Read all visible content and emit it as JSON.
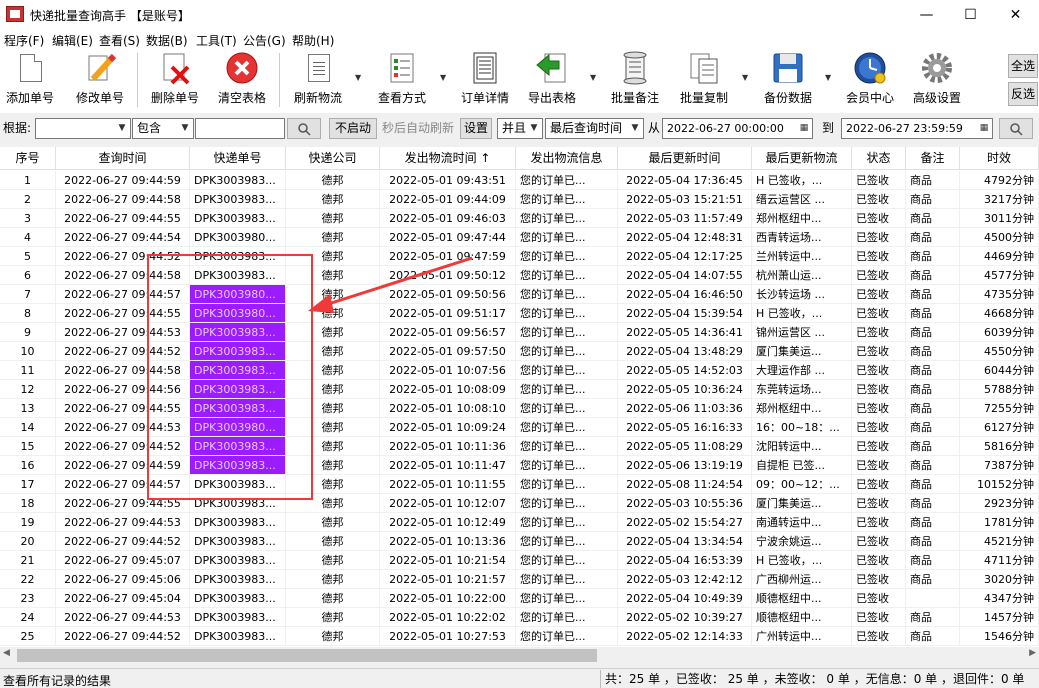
{
  "title": "快递批量查询高手 【是账号】",
  "window_controls": {
    "minimize": "—",
    "maximize": "☐",
    "close": "✕"
  },
  "menu": [
    "程序(F)",
    "编辑(E)",
    "查看(S)",
    "数据(B)",
    "工具(T)",
    "公告(G)",
    "帮助(H)"
  ],
  "toolbar": [
    "添加单号",
    "修改单号",
    "删除单号",
    "清空表格",
    "刷新物流",
    "查看方式",
    "订单详情",
    "导出表格",
    "批量备注",
    "批量复制",
    "备份数据",
    "会员中心",
    "高级设置"
  ],
  "select_panel": {
    "select_all": "全选",
    "invert": "反选"
  },
  "filter": {
    "basis_label": "根据:",
    "basis_value": "",
    "match_value": "包含",
    "search_value": "",
    "auto_refresh_btn": "不启动",
    "auto_refresh_text": "秒后自动刷新",
    "settings_btn": "设置",
    "logic_value": "并且",
    "time_field": "最后查询时间",
    "from_label": "从",
    "from_value": "2022-06-27 00:00:00",
    "to_label": "到",
    "to_value": "2022-06-27 23:59:59"
  },
  "columns": [
    "序号",
    "查询时间",
    "快递单号",
    "快递公司",
    "发出物流时间 ↑",
    "发出物流信息",
    "最后更新时间",
    "最后更新物流",
    "状态",
    "备注",
    "时效"
  ],
  "rows": [
    [
      "1",
      "2022-06-27 09:44:59",
      "DPK3003983...",
      "德邦",
      "2022-05-01 09:43:51",
      "您的订单已...",
      "2022-05-04 17:36:45",
      "H 已签收，...",
      "已签收",
      "商品",
      "4792分钟"
    ],
    [
      "2",
      "2022-06-27 09:44:58",
      "DPK3003983...",
      "德邦",
      "2022-05-01 09:44:09",
      "您的订单已...",
      "2022-05-03 15:21:51",
      "缙云运营区 ...",
      "已签收",
      "商品",
      "3217分钟"
    ],
    [
      "3",
      "2022-06-27 09:44:55",
      "DPK3003983...",
      "德邦",
      "2022-05-01 09:46:03",
      "您的订单已...",
      "2022-05-03 11:57:49",
      "郑州枢纽中...",
      "已签收",
      "商品",
      "3011分钟"
    ],
    [
      "4",
      "2022-06-27 09:44:54",
      "DPK3003980...",
      "德邦",
      "2022-05-01 09:47:44",
      "您的订单已...",
      "2022-05-04 12:48:31",
      "西青转运场...",
      "已签收",
      "商品",
      "4500分钟"
    ],
    [
      "5",
      "2022-06-27 09:44:52",
      "DPK3003983...",
      "德邦",
      "2022-05-01 09:47:59",
      "您的订单已...",
      "2022-05-04 12:17:25",
      "兰州转运中...",
      "已签收",
      "商品",
      "4469分钟"
    ],
    [
      "6",
      "2022-06-27 09:44:58",
      "DPK3003983...",
      "德邦",
      "2022-05-01 09:50:12",
      "您的订单已...",
      "2022-05-04 14:07:55",
      "杭州萧山运...",
      "已签收",
      "商品",
      "4577分钟"
    ],
    [
      "7",
      "2022-06-27 09:44:57",
      "DPK3003980...",
      "德邦",
      "2022-05-01 09:50:56",
      "您的订单已...",
      "2022-05-04 16:46:50",
      "长沙转运场 ...",
      "已签收",
      "商品",
      "4735分钟"
    ],
    [
      "8",
      "2022-06-27 09:44:55",
      "DPK3003980...",
      "德邦",
      "2022-05-01 09:51:17",
      "您的订单已...",
      "2022-05-04 15:39:54",
      "H 已签收，...",
      "已签收",
      "商品",
      "4668分钟"
    ],
    [
      "9",
      "2022-06-27 09:44:53",
      "DPK3003983...",
      "德邦",
      "2022-05-01 09:56:57",
      "您的订单已...",
      "2022-05-05 14:36:41",
      "锦州运营区 ...",
      "已签收",
      "商品",
      "6039分钟"
    ],
    [
      "10",
      "2022-06-27 09:44:52",
      "DPK3003983...",
      "德邦",
      "2022-05-01 09:57:50",
      "您的订单已...",
      "2022-05-04 13:48:29",
      "厦门集美运...",
      "已签收",
      "商品",
      "4550分钟"
    ],
    [
      "11",
      "2022-06-27 09:44:58",
      "DPK3003983...",
      "德邦",
      "2022-05-01 10:07:56",
      "您的订单已...",
      "2022-05-05 14:52:03",
      "大理运作部 ...",
      "已签收",
      "商品",
      "6044分钟"
    ],
    [
      "12",
      "2022-06-27 09:44:56",
      "DPK3003983...",
      "德邦",
      "2022-05-01 10:08:09",
      "您的订单已...",
      "2022-05-05 10:36:24",
      "东莞转运场...",
      "已签收",
      "商品",
      "5788分钟"
    ],
    [
      "13",
      "2022-06-27 09:44:55",
      "DPK3003983...",
      "德邦",
      "2022-05-01 10:08:10",
      "您的订单已...",
      "2022-05-06 11:03:36",
      "郑州枢纽中...",
      "已签收",
      "商品",
      "7255分钟"
    ],
    [
      "14",
      "2022-06-27 09:44:53",
      "DPK3003980...",
      "德邦",
      "2022-05-01 10:09:24",
      "您的订单已...",
      "2022-05-05 16:16:33",
      "16：00~18：...",
      "已签收",
      "商品",
      "6127分钟"
    ],
    [
      "15",
      "2022-06-27 09:44:52",
      "DPK3003983...",
      "德邦",
      "2022-05-01 10:11:36",
      "您的订单已...",
      "2022-05-05 11:08:29",
      "沈阳转运中...",
      "已签收",
      "商品",
      "5816分钟"
    ],
    [
      "16",
      "2022-06-27 09:44:59",
      "DPK3003983...",
      "德邦",
      "2022-05-01 10:11:47",
      "您的订单已...",
      "2022-05-06 13:19:19",
      "自提柜 已签...",
      "已签收",
      "商品",
      "7387分钟"
    ],
    [
      "17",
      "2022-06-27 09:44:57",
      "DPK3003983...",
      "德邦",
      "2022-05-01 10:11:55",
      "您的订单已...",
      "2022-05-08 11:24:54",
      "09：00~12：...",
      "已签收",
      "商品",
      "10152分钟"
    ],
    [
      "18",
      "2022-06-27 09:44:55",
      "DPK3003983...",
      "德邦",
      "2022-05-01 10:12:07",
      "您的订单已...",
      "2022-05-03 10:55:36",
      "厦门集美运...",
      "已签收",
      "商品",
      "2923分钟"
    ],
    [
      "19",
      "2022-06-27 09:44:53",
      "DPK3003983...",
      "德邦",
      "2022-05-01 10:12:49",
      "您的订单已...",
      "2022-05-02 15:54:27",
      "南通转运中...",
      "已签收",
      "商品",
      "1781分钟"
    ],
    [
      "20",
      "2022-06-27 09:44:52",
      "DPK3003983...",
      "德邦",
      "2022-05-01 10:13:36",
      "您的订单已...",
      "2022-05-04 13:34:54",
      "宁波余姚运...",
      "已签收",
      "商品",
      "4521分钟"
    ],
    [
      "21",
      "2022-06-27 09:45:07",
      "DPK3003983...",
      "德邦",
      "2022-05-01 10:21:54",
      "您的订单已...",
      "2022-05-04 16:53:39",
      "H 已签收，...",
      "已签收",
      "商品",
      "4711分钟"
    ],
    [
      "22",
      "2022-06-27 09:45:06",
      "DPK3003983...",
      "德邦",
      "2022-05-01 10:21:57",
      "您的订单已...",
      "2022-05-03 12:42:12",
      "广西柳州运...",
      "已签收",
      "商品",
      "3020分钟"
    ],
    [
      "23",
      "2022-06-27 09:45:04",
      "DPK3003983...",
      "德邦",
      "2022-05-01 10:22:00",
      "您的订单已...",
      "2022-05-04 10:49:39",
      "顺德枢纽中...",
      "已签收",
      "",
      "4347分钟"
    ],
    [
      "24",
      "2022-06-27 09:44:53",
      "DPK3003983...",
      "德邦",
      "2022-05-01 10:22:02",
      "您的订单已...",
      "2022-05-02 10:39:27",
      "顺德枢纽中...",
      "已签收",
      "商品",
      "1457分钟"
    ],
    [
      "25",
      "2022-06-27 09:44:52",
      "DPK3003983...",
      "德邦",
      "2022-05-01 10:27:53",
      "您的订单已...",
      "2022-05-02 12:14:33",
      "广州转运中...",
      "已签收",
      "商品",
      "1546分钟"
    ]
  ],
  "scroll_arrows": {
    "left": "◀",
    "right": "▶"
  },
  "status": {
    "left": "查看所有记录的结果",
    "right": "共：25 单 ，已签收： 25 单 ，未签收： 0 单 ，无信息：0 单 ，退回件：0 单"
  },
  "colors": {
    "highlight": "#9b1cff",
    "annotation": "#f03a3a"
  }
}
